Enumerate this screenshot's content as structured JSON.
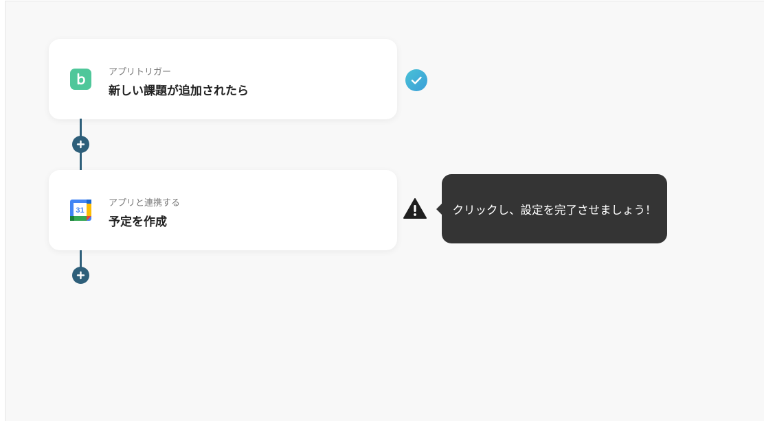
{
  "flow": {
    "steps": [
      {
        "subtitle": "アプリトリガー",
        "title": "新しい課題が追加されたら",
        "app_icon": "backlog-icon",
        "status": "complete",
        "status_icon": "check-circle-icon"
      },
      {
        "subtitle": "アプリと連携する",
        "title": "予定を作成",
        "app_icon": "google-calendar-icon",
        "calendar_day": "31",
        "status": "warning",
        "status_icon": "warning-icon"
      }
    ],
    "add_step_icon": "plus-icon"
  },
  "tooltip": {
    "text": "クリックし、設定を完了させましょう！"
  },
  "colors": {
    "connector": "#2e5f7a",
    "backlog_green": "#4fc79a",
    "check_start": "#49c1d6",
    "check_end": "#3a9ed8",
    "tooltip_bg": "#343434",
    "warning": "#1f1f1f"
  }
}
